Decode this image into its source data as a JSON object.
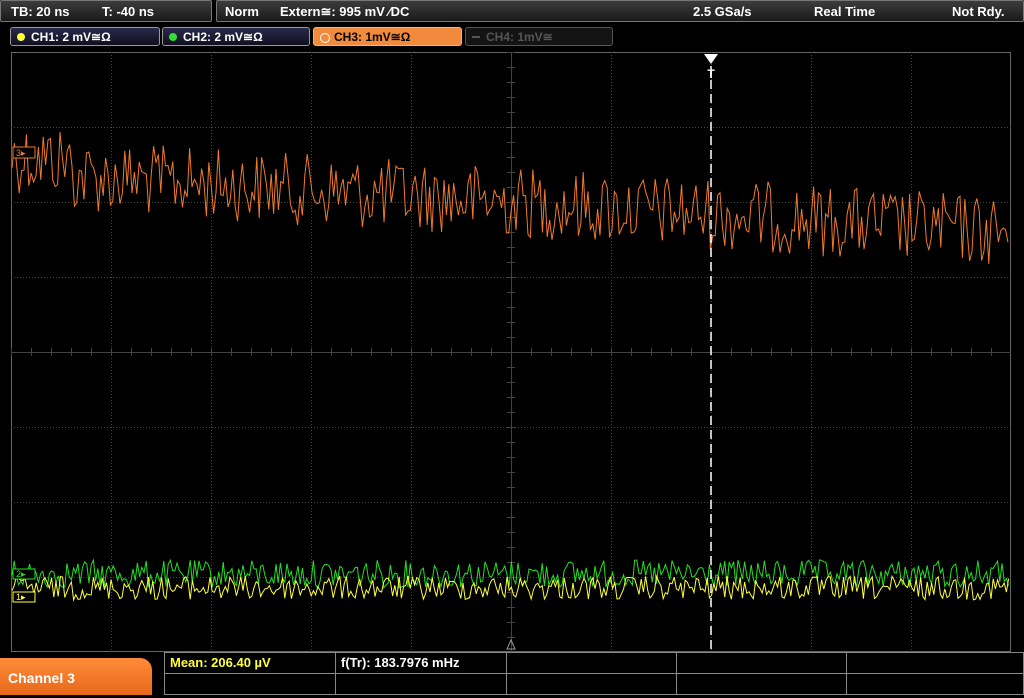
{
  "topbar": {
    "timebase": "TB: 20 ns",
    "trigger_time": "T: -40 ns",
    "mode": "Norm",
    "trigger_source": "Extern≅: 995 mV ⁄DC",
    "sample_rate": "2.5 GSa/s",
    "acq_mode": "Real Time",
    "status": "Not Rdy."
  },
  "channels": [
    {
      "label": "CH1: 2 mV≅Ω",
      "color": "#ffff3c",
      "state": "on"
    },
    {
      "label": "CH2: 2 mV≅Ω",
      "color": "#33dd33",
      "state": "on"
    },
    {
      "label": "CH3: 1mV≅Ω",
      "color": "#f08a3c",
      "state": "active"
    },
    {
      "label": "CH4: 1mV≅",
      "color": "#555555",
      "state": "off"
    }
  ],
  "markers": {
    "ch1": "1▸",
    "ch2": "2▸",
    "ch3": "3▸",
    "trigger": "T"
  },
  "bottom": {
    "tab": "Channel 3",
    "mean": "Mean: 206.40 µV",
    "freq": "f(Tr): 183.7976 mHz"
  },
  "colors": {
    "ch1": "#ffff3c",
    "ch2": "#22e022",
    "ch3": "#f07a2a",
    "grid": "#444444",
    "trigger_line": "#ffffff"
  }
}
